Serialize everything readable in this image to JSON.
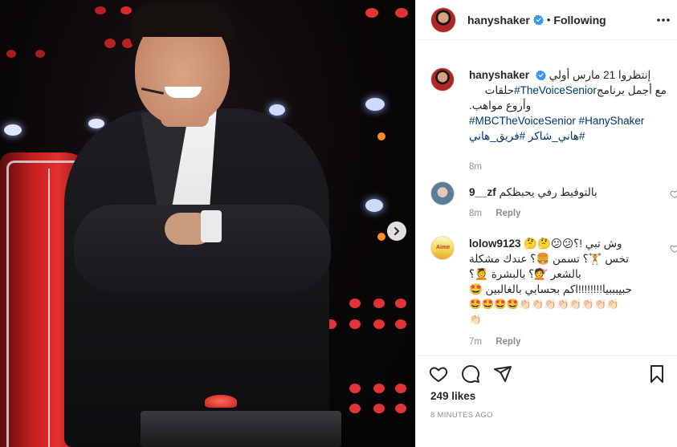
{
  "post": {
    "username": "hanyshaker",
    "follow_status": "Following",
    "separator": "•"
  },
  "caption": {
    "username": "hanyshaker",
    "line1": "إنتظروا 21 مارس أولي",
    "line2_prefix": "حلقات ",
    "line2_tag": "#TheVoiceSenior",
    "line2_suffix": " مع أجمل برنامج",
    "line3": "وأروع مواهب.",
    "line4_tags": "#MBCTheVoiceSenior #HanyShaker",
    "line5_tags": "#هاني_شاكر #فريق_هاني",
    "time": "8m"
  },
  "comments": [
    {
      "username": "9__zf",
      "text": "بالتوفيط رفي يحبظكم",
      "time": "8m",
      "reply": "Reply"
    },
    {
      "username": "lolow9123",
      "line1": "🤔🤔😕😕وش تبي !؟",
      "line2": "تخس 🏋️؟ تسمن 🍔؟ عندك مشكلة",
      "line3": "بالشعر 💇؟ بالبشرة 💆؟",
      "line4": "حبيبببيا!!!!!!!!اكم بحسابي بالغالبين 🤩",
      "line5": "🤩🤩🤩🤩👏🏻👏🏻👏🏻👏🏻👏🏻👏🏻👏🏻👏🏻",
      "line6": "👏🏻",
      "time": "7m",
      "reply": "Reply",
      "avatar_text": "Aime"
    }
  ],
  "likes": "249 likes",
  "posted": "8 MINUTES AGO",
  "icons": {
    "like": "heart-icon",
    "comment": "comment-icon",
    "share": "share-icon",
    "save": "bookmark-icon",
    "more": "more-icon",
    "next": "chevron-right-icon",
    "verified": "verified-badge-icon"
  },
  "colors": {
    "hashtag": "#00376b",
    "verified": "#3897f0",
    "muted": "#8e8e8e"
  }
}
